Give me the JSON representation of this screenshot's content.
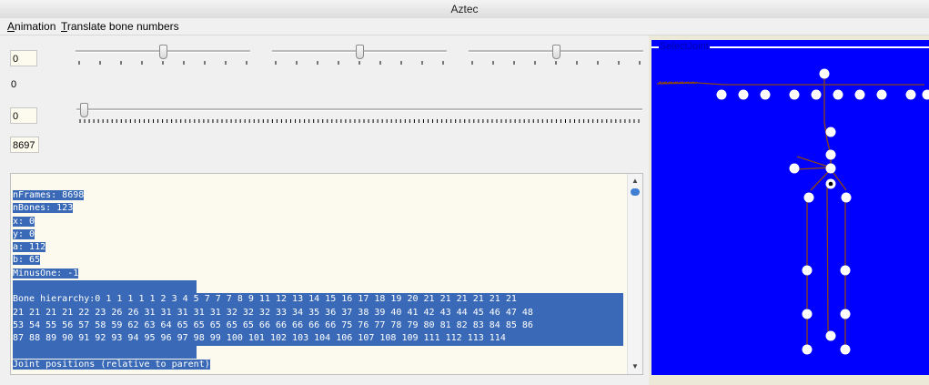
{
  "window": {
    "title": "Aztec"
  },
  "menu": {
    "items": [
      "Animation",
      "Translate bone numbers"
    ]
  },
  "controls": {
    "field1": "0",
    "label1": "0",
    "field2": "0",
    "field3": "8697",
    "slider_a_value": 0.5,
    "slider_b_value": 0.5,
    "slider_c_value": 0.5,
    "frame_slider_value": 0.0
  },
  "text_output": {
    "lines": [
      "nFrames: 8698",
      "nBones: 123",
      "x: 0",
      "y: 0",
      "a: 112",
      "b: 65",
      "MinusOne: -1",
      "",
      "Bone hierarchy:0 1 1 1 1 1 2 3 4 5 7 7 7 8 9 11 12 13 14 15 16 17 18 19 20 21 21 21 21 21 21",
      "21 21 21 21 22 23 26 26 31 31 31 31 31 32 32 32 33 34 35 36 37 38 39 40 41 42 43 44 45 46 47 48",
      "53 54 55 56 57 58 59 62 63 64 65 65 65 65 65 66 66 66 66 66 75 76 77 78 79 80 81 82 83 84 85 86",
      "87 88 89 90 91 92 93 94 95 96 97 98 99 100 101 102 103 104 106 107 108 109 111 112 113 114",
      "",
      "Joint positions (relative to parent)"
    ]
  },
  "joint_panel": {
    "label": "SelectJoint",
    "background": "#0000ff",
    "joint_color": "#ffffff",
    "bone_color": "#8b4513"
  }
}
